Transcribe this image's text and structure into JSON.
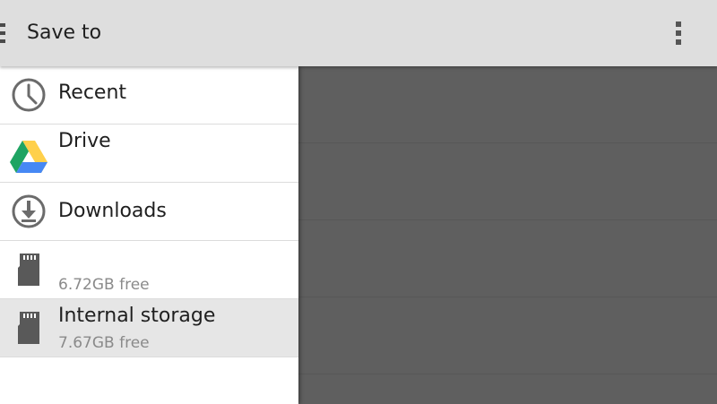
{
  "header": {
    "title": "Save to",
    "nav_icon": "drawer-toggle-icon",
    "menu_icon": "overflow-menu-icon"
  },
  "drawer": {
    "items": [
      {
        "label": "Recent",
        "summary": "",
        "icon": "clock-icon"
      },
      {
        "label": "Drive",
        "summary": "",
        "icon": "google-drive-icon"
      },
      {
        "label": "Downloads",
        "summary": "",
        "icon": "download-icon"
      },
      {
        "label": "",
        "summary": "6.72GB free",
        "icon": "sd-card-icon"
      },
      {
        "label": "Internal storage",
        "summary": "7.67GB free",
        "icon": "sd-card-icon",
        "selected": true
      }
    ]
  },
  "colors": {
    "toolbar": "#dedede",
    "scrim": "#5f5f5f",
    "selected_row": "#e6e6e6",
    "drive_green": "#1fa463",
    "drive_yellow": "#ffd04b",
    "drive_blue": "#4688f4"
  }
}
